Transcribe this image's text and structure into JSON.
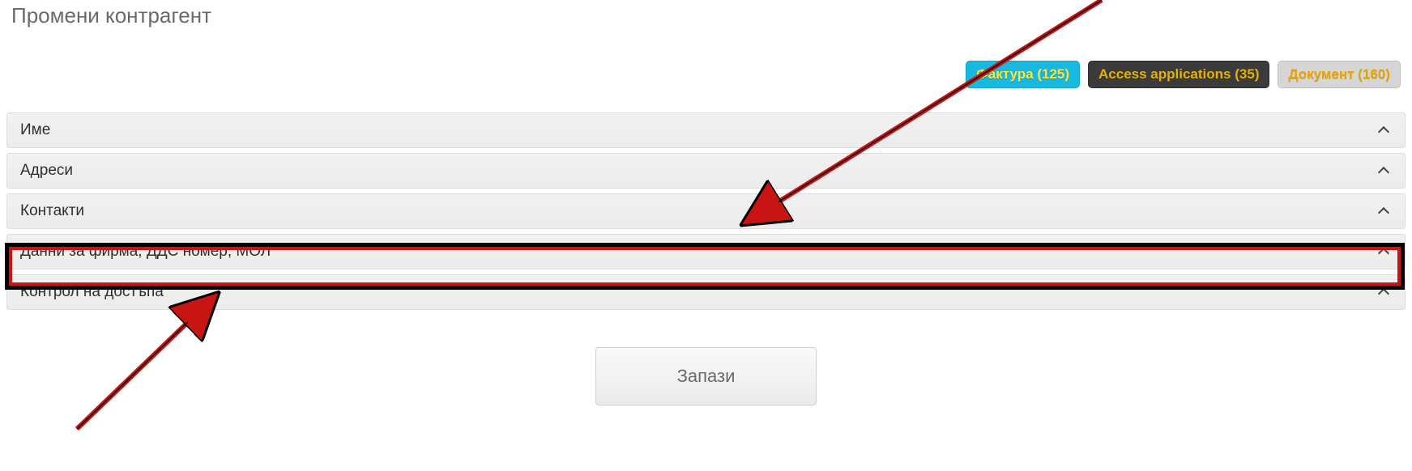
{
  "page_title": "Промени контрагент",
  "badges": [
    {
      "label": "Фактура",
      "count": 125
    },
    {
      "label": "Access applications",
      "count": 35
    },
    {
      "label": "Документ",
      "count": 160
    }
  ],
  "accordion": [
    {
      "label": "Име"
    },
    {
      "label": "Адреси"
    },
    {
      "label": "Контакти"
    },
    {
      "label": "Данни за фирма, ДДС номер, МОЛ"
    },
    {
      "label": "Контрол на достъпа"
    }
  ],
  "save_label": "Запази"
}
